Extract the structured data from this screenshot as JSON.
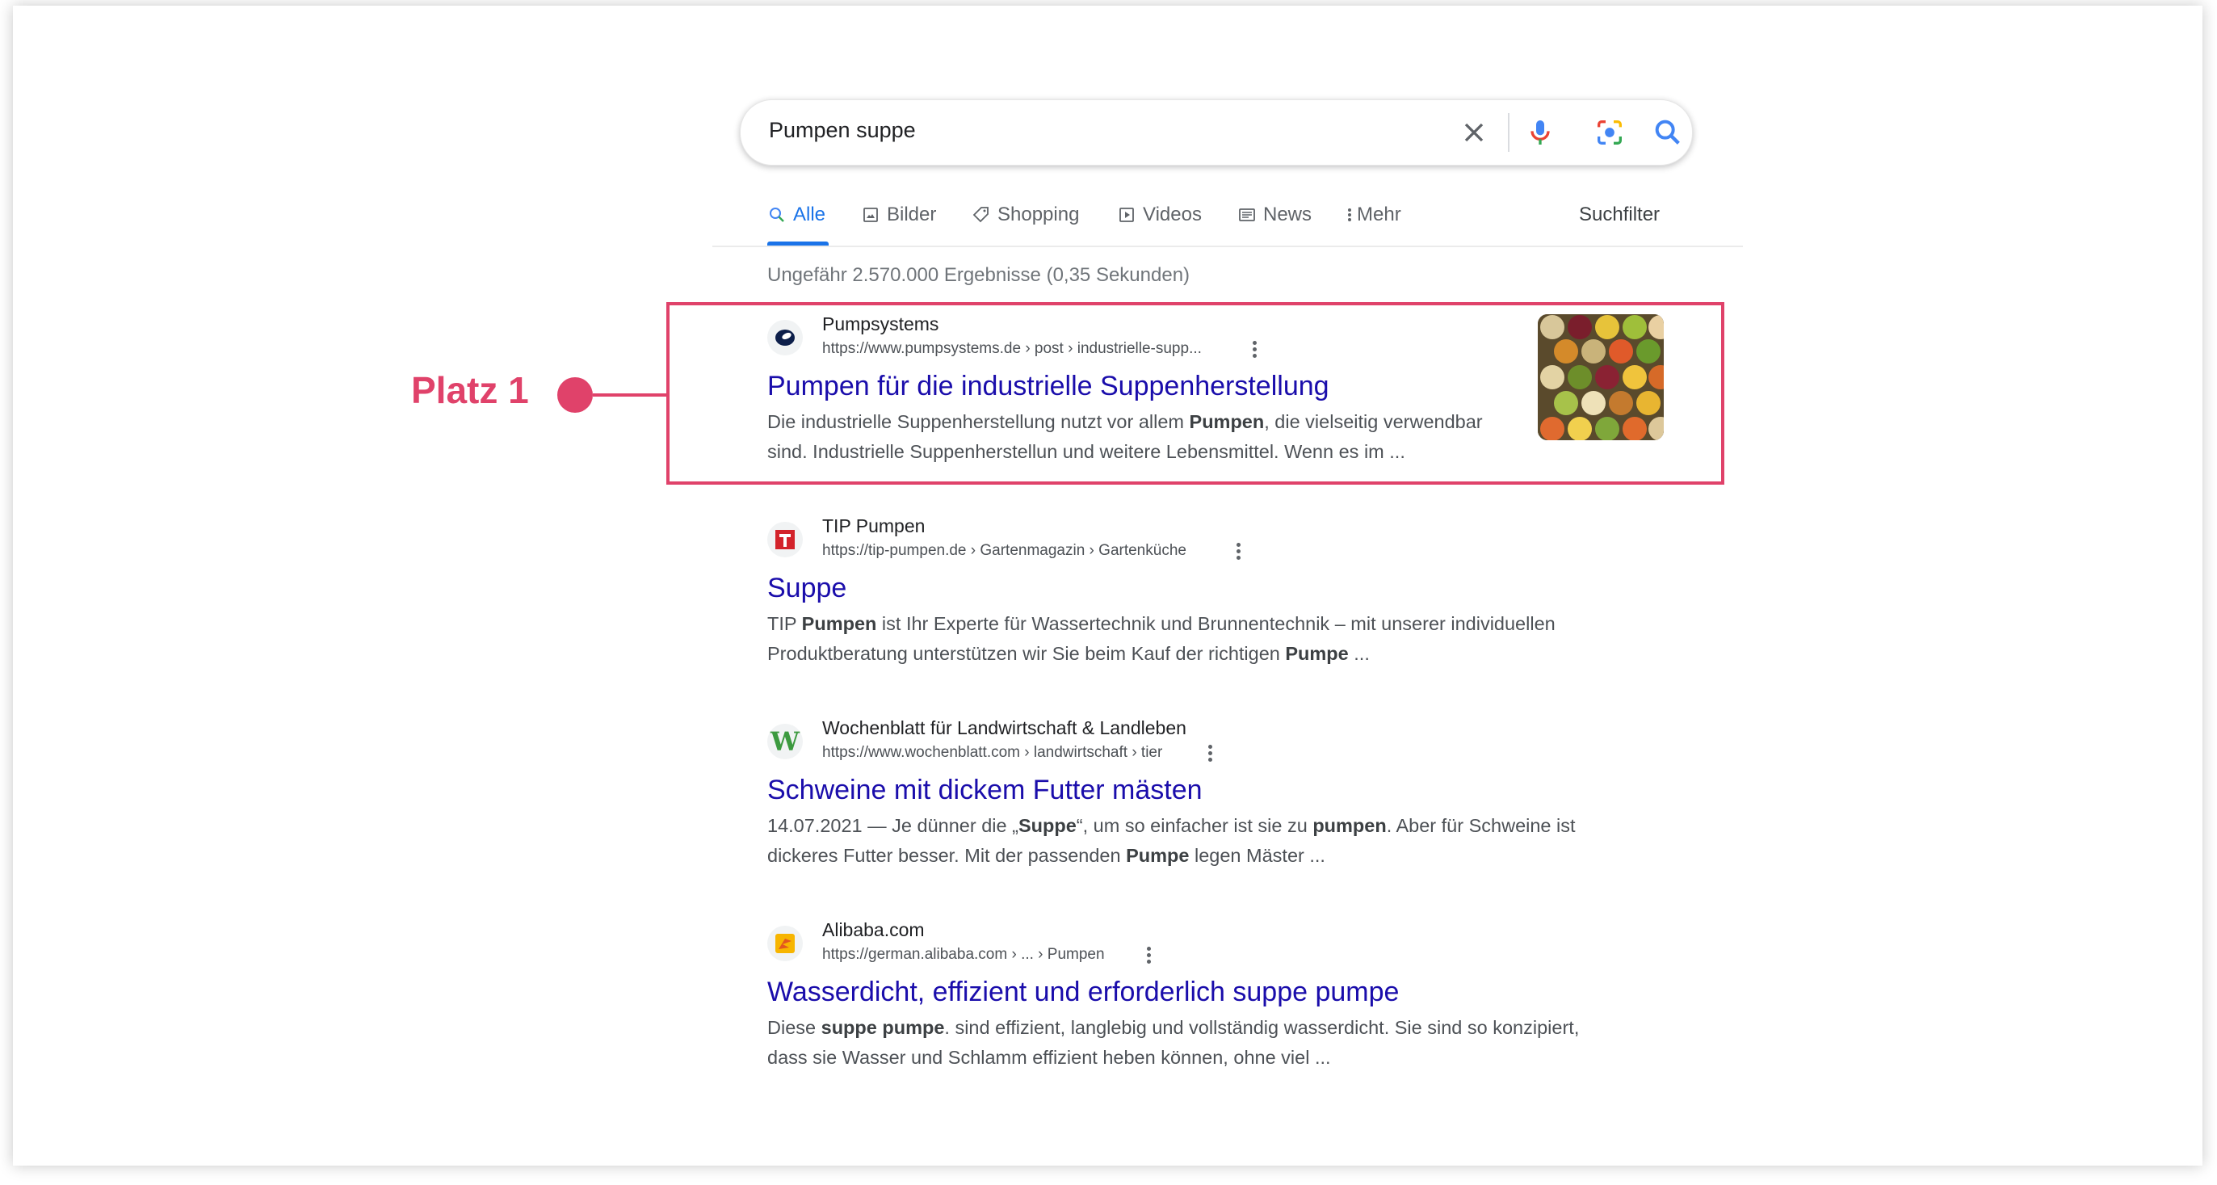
{
  "search": {
    "query": "Pumpen suppe"
  },
  "tabs": [
    {
      "label": "Alle",
      "icon": "search-icon",
      "active": true
    },
    {
      "label": "Bilder",
      "icon": "image-icon"
    },
    {
      "label": "Shopping",
      "icon": "tag-icon"
    },
    {
      "label": "Videos",
      "icon": "play-icon"
    },
    {
      "label": "News",
      "icon": "newspaper-icon"
    },
    {
      "label": "Mehr",
      "icon": "more-vert-icon"
    }
  ],
  "filter_label": "Suchfilter",
  "results_count": "Ungefähr 2.570.000 Ergebnisse (0,35 Sekunden)",
  "annotation": {
    "label": "Platz 1",
    "color": "#e0426a"
  },
  "results": [
    {
      "site": "Pumpsystems",
      "url": "https://www.pumpsystems.de › post › industrielle-supp...",
      "title": "Pumpen für die industrielle Suppenherstellung",
      "snippet_parts": [
        {
          "t": "Die industrielle Suppenherstellung nutzt vor allem "
        },
        {
          "t": "Pumpen",
          "b": true
        },
        {
          "t": ", die vielseitig verwendbar sind. Industrielle Suppenherstellun und weitere Lebensmittel. Wenn es im ..."
        }
      ],
      "favicon": "pumpsystems-logo-icon",
      "has_thumbnail": true
    },
    {
      "site": "TIP Pumpen",
      "url": "https://tip-pumpen.de › Gartenmagazin › Gartenküche",
      "title": "Suppe",
      "snippet_parts": [
        {
          "t": "TIP "
        },
        {
          "t": "Pumpen",
          "b": true
        },
        {
          "t": " ist Ihr Experte für Wassertechnik und Brunnentechnik – mit unserer individuellen Produktberatung unterstützen wir Sie beim Kauf der richtigen "
        },
        {
          "t": "Pumpe",
          "b": true
        },
        {
          "t": " ..."
        }
      ],
      "favicon": "tip-logo-icon"
    },
    {
      "site": "Wochenblatt für Landwirtschaft & Landleben",
      "url": "https://www.wochenblatt.com › landwirtschaft › tier",
      "title": "Schweine mit dickem Futter mästen",
      "snippet_parts": [
        {
          "t": "14.07.2021 — Je dünner die „"
        },
        {
          "t": "Suppe",
          "b": true
        },
        {
          "t": "“, um so einfacher ist sie zu "
        },
        {
          "t": "pumpen",
          "b": true
        },
        {
          "t": ". Aber für Schweine ist dickeres Futter besser. Mit der passenden "
        },
        {
          "t": "Pumpe",
          "b": true
        },
        {
          "t": " legen Mäster ..."
        }
      ],
      "favicon": "wochenblatt-logo-icon"
    },
    {
      "site": "Alibaba.com",
      "url": "https://german.alibaba.com › ... › Pumpen",
      "title": "Wasserdicht, effizient und erforderlich suppe pumpe",
      "snippet_parts": [
        {
          "t": "Diese "
        },
        {
          "t": "suppe pumpe",
          "b": true
        },
        {
          "t": ". sind effizient, langlebig und vollständig wasserdicht. Sie sind so konzipiert, dass sie Wasser und Schlamm effizient heben können, ohne viel ..."
        }
      ],
      "favicon": "alibaba-logo-icon"
    }
  ]
}
